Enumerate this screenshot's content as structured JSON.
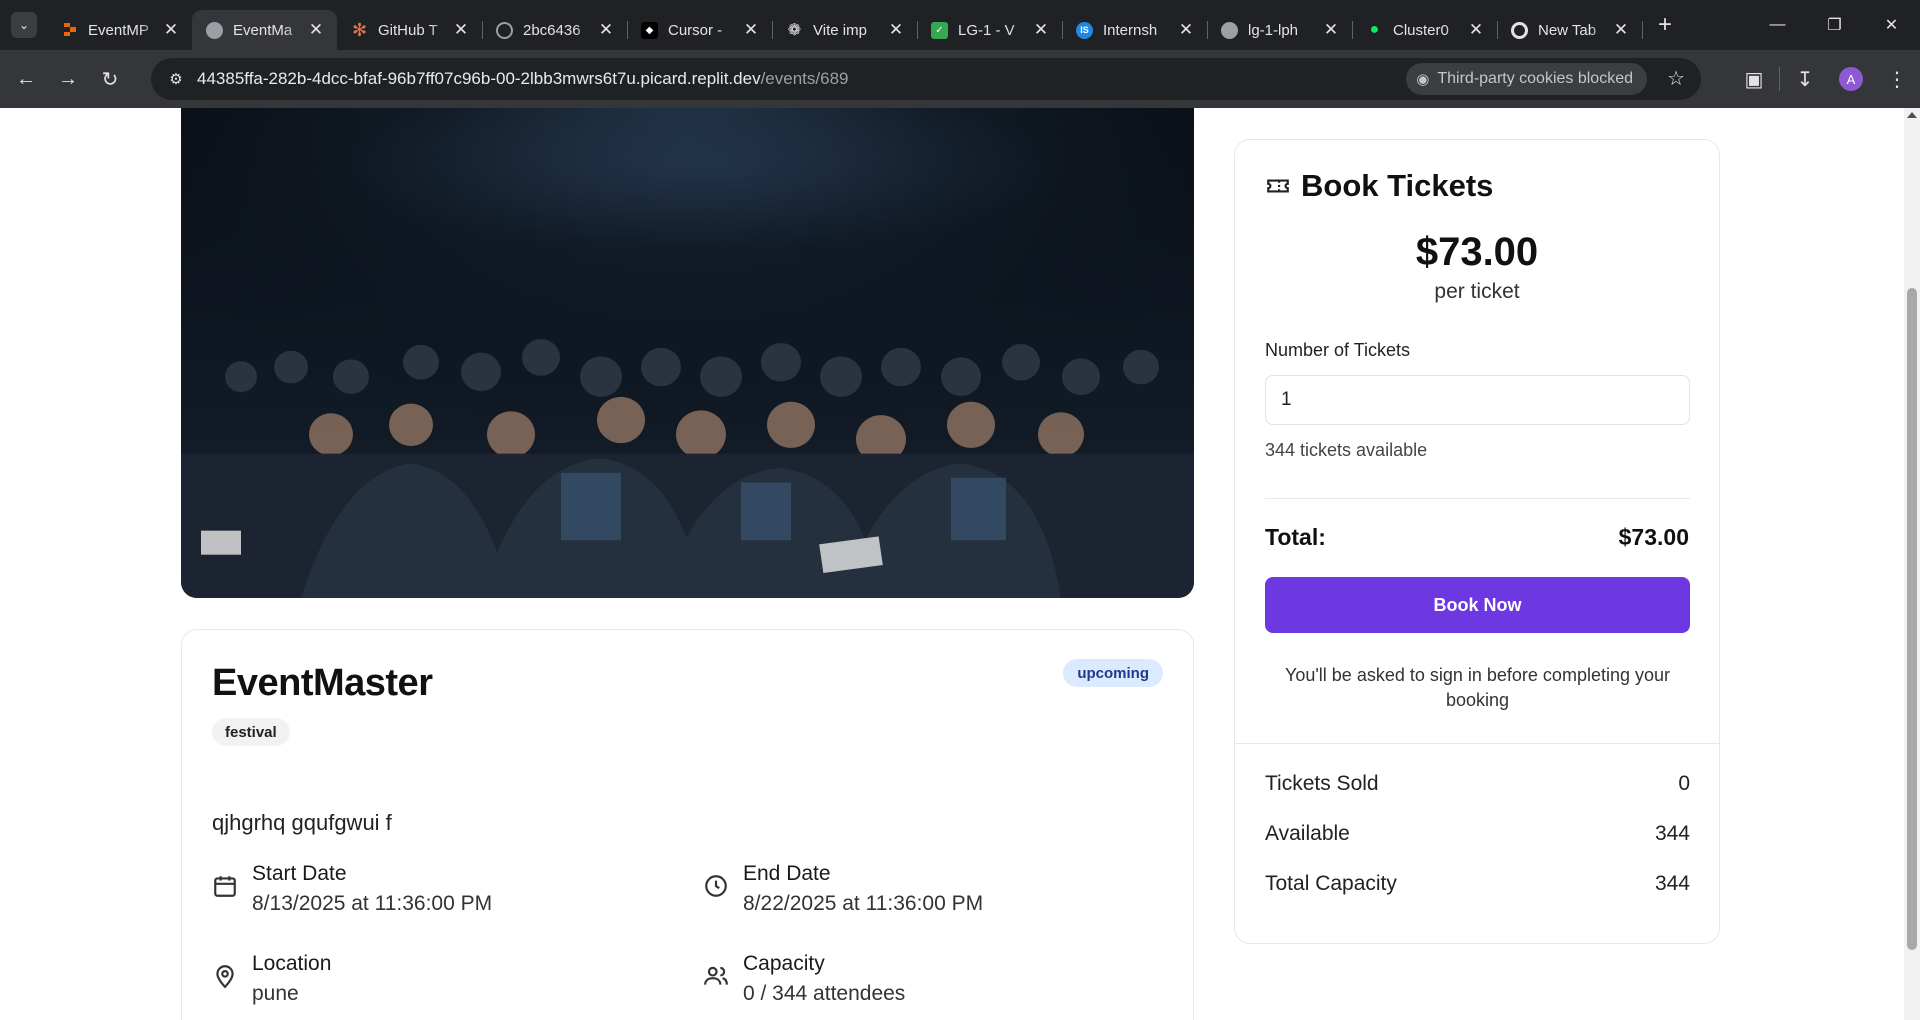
{
  "browser": {
    "tabs": [
      {
        "title": "EventMP",
        "favicon": "replit-icon",
        "color": "#f26207"
      },
      {
        "title": "EventMa",
        "favicon": "globe-icon",
        "color": "#9aa0a6",
        "active": true
      },
      {
        "title": "GitHub T",
        "favicon": "claude-icon",
        "color": "#d97757"
      },
      {
        "title": "2bc6436",
        "favicon": "spinner-icon",
        "color": "#9aa0a6"
      },
      {
        "title": "Cursor -",
        "favicon": "cursor-icon",
        "color": "#ffffff"
      },
      {
        "title": "Vite imp",
        "favicon": "openai-icon",
        "color": "#e3e3e3"
      },
      {
        "title": "LG-1 - V",
        "favicon": "check-doc-icon",
        "color": "#34a853"
      },
      {
        "title": "Internsh",
        "favicon": "is-icon",
        "color": "#1e88e5"
      },
      {
        "title": "lg-1-lph",
        "favicon": "globe-icon",
        "color": "#9aa0a6"
      },
      {
        "title": "Cluster0",
        "favicon": "mongodb-icon",
        "color": "#00ed64"
      },
      {
        "title": "New Tab",
        "favicon": "chrome-icon",
        "color": "#e3e3e3"
      }
    ],
    "url_host": "44385ffa-282b-4dcc-bfaf-96b7ff07c96b-00-2lbb3mwrs6t7u.picard.replit.dev",
    "url_path": "/events/689",
    "cookie_chip": "Third-party cookies blocked",
    "profile_initial": "A"
  },
  "event": {
    "title": "EventMaster",
    "status": "upcoming",
    "category": "festival",
    "description": "qjhgrhq gqufgwui f",
    "start_label": "Start Date",
    "start_value": "8/13/2025 at 11:36:00 PM",
    "end_label": "End Date",
    "end_value": "8/22/2025 at 11:36:00 PM",
    "location_label": "Location",
    "location_value": "pune",
    "capacity_label": "Capacity",
    "capacity_value": "0 / 344 attendees"
  },
  "booking": {
    "heading": "Book Tickets",
    "price": "$73.00",
    "per_ticket": "per ticket",
    "qty_label": "Number of Tickets",
    "qty_value": "1",
    "available_note": "344 tickets available",
    "total_label": "Total:",
    "total_value": "$73.00",
    "book_button": "Book Now",
    "signin_note": "You'll be asked to sign in before completing your booking",
    "brand_color": "#6d37e2"
  },
  "stats": [
    {
      "label": "Tickets Sold",
      "value": "0"
    },
    {
      "label": "Available",
      "value": "344"
    },
    {
      "label": "Total Capacity",
      "value": "344"
    }
  ]
}
